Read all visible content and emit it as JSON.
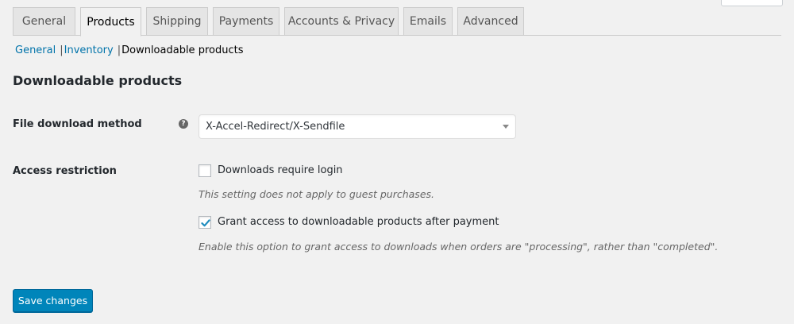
{
  "tabs": [
    {
      "label": "General",
      "active": false
    },
    {
      "label": "Products",
      "active": true
    },
    {
      "label": "Shipping",
      "active": false
    },
    {
      "label": "Payments",
      "active": false
    },
    {
      "label": "Accounts & Privacy",
      "active": false
    },
    {
      "label": "Emails",
      "active": false
    },
    {
      "label": "Advanced",
      "active": false
    }
  ],
  "subnav": {
    "general": "General",
    "inventory": "Inventory",
    "separator": "|",
    "current": "Downloadable products"
  },
  "section": {
    "title": "Downloadable products"
  },
  "download_method": {
    "label": "File download method",
    "help_glyph": "?",
    "selected": "X-Accel-Redirect/X-Sendfile"
  },
  "access": {
    "label": "Access restriction",
    "require_login": {
      "label": "Downloads require login",
      "checked": false,
      "description": "This setting does not apply to guest purchases."
    },
    "grant_access": {
      "label": "Grant access to downloadable products after payment",
      "checked": true,
      "description": "Enable this option to grant access to downloads when orders are \"processing\", rather than \"completed\"."
    }
  },
  "actions": {
    "save_label": "Save changes"
  },
  "colors": {
    "accent": "#0085ba",
    "link": "#0073aa",
    "check": "#1e8cbe"
  }
}
